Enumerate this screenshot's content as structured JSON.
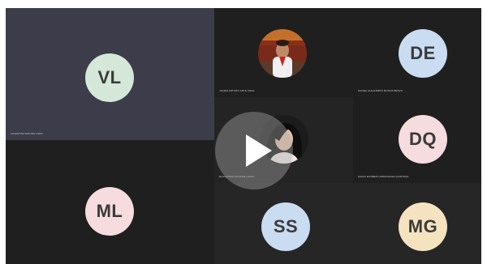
{
  "participants": [
    {
      "initials": "VL",
      "name": "VALENTINA MOLINA LORA",
      "avatar_color": "#d4e7d8"
    },
    {
      "initials": "",
      "name": "JAVIER ARTURO ARTE VIDAL",
      "avatar_color": "#a85a2c"
    },
    {
      "initials": "DE",
      "name": "DANIEL ALEJANDRO MUNOZ BRAVO",
      "avatar_color": "#c9dcf2"
    },
    {
      "initials": "",
      "name": "ROCHANNA TAGOVIZ LAGEY",
      "avatar_color": "#2a2a2a"
    },
    {
      "initials": "DQ",
      "name": "DARIO ESTEBAN RODRIGUEZ QUINTANA",
      "avatar_color": "#f6dcde"
    },
    {
      "initials": "ML",
      "name": "",
      "avatar_color": "#f6dcde"
    },
    {
      "initials": "SS",
      "name": "",
      "avatar_color": "#c9dcf2"
    },
    {
      "initials": "MG",
      "name": "",
      "avatar_color": "#f5e3c0"
    }
  ],
  "colors": {
    "active_tile": "#3c3c4a",
    "tile_dark": "#1f1f1f",
    "tile_mid": "#262626"
  },
  "play_overlay": {
    "icon": "play-icon"
  }
}
